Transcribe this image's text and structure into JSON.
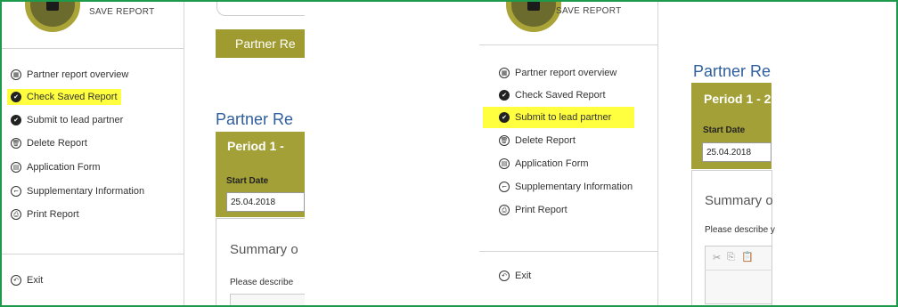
{
  "left": {
    "logo_label": "SAVE REPORT",
    "menu": [
      {
        "label": "Partner report overview",
        "icon": "grid-icon",
        "glyph": "▦"
      },
      {
        "label": "Check Saved Report",
        "icon": "check-icon",
        "glyph": "✔"
      },
      {
        "label": "Submit to lead partner",
        "icon": "check-icon",
        "glyph": "✔"
      },
      {
        "label": "Delete Report",
        "icon": "trash-icon",
        "glyph": "🗑"
      },
      {
        "label": "Application Form",
        "icon": "document-icon",
        "glyph": "▤"
      },
      {
        "label": "Supplementary Information",
        "icon": "paperclip-icon",
        "glyph": "⌐"
      },
      {
        "label": "Print Report",
        "icon": "print-icon",
        "glyph": "⎙"
      }
    ],
    "exit_label": "Exit",
    "banner": "Partner Re",
    "title": "Partner Re",
    "period_title": "Period 1 -",
    "start_date_label": "Start Date",
    "start_date_value": "25.04.2018",
    "summary": "Summary o",
    "describe": "Please describe"
  },
  "right": {
    "logo_label": "SAVE REPORT",
    "menu": [
      {
        "label": "Partner report overview",
        "icon": "grid-icon",
        "glyph": "▦"
      },
      {
        "label": "Check Saved Report",
        "icon": "check-icon",
        "glyph": "✔"
      },
      {
        "label": "Submit to lead partner",
        "icon": "check-icon",
        "glyph": "✔"
      },
      {
        "label": "Delete Report",
        "icon": "trash-icon",
        "glyph": "🗑"
      },
      {
        "label": "Application Form",
        "icon": "document-icon",
        "glyph": "▤"
      },
      {
        "label": "Supplementary Information",
        "icon": "paperclip-icon",
        "glyph": "⌐"
      },
      {
        "label": "Print Report",
        "icon": "print-icon",
        "glyph": "⎙"
      }
    ],
    "exit_label": "Exit",
    "title": "Partner Re",
    "period_title": "Period 1 - 2",
    "start_date_label": "Start Date",
    "start_date_value": "25.04.2018",
    "summary": "Summary o",
    "describe": "Please describe y"
  },
  "colors": {
    "frame": "#1e9a4c",
    "olive": "#a4a038",
    "highlight": "#ffff40",
    "title_blue": "#2e5e9c"
  }
}
